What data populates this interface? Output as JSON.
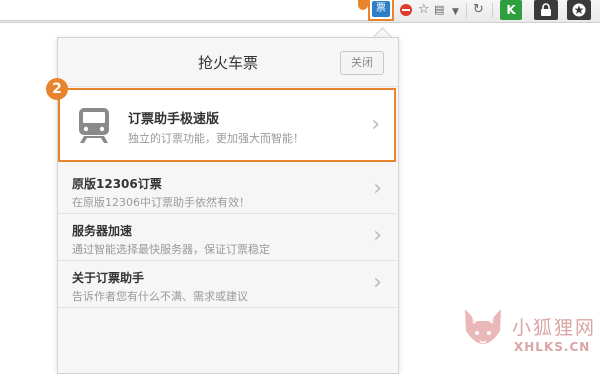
{
  "toolbar": {
    "ticket_ext_label": "票",
    "k_ext_label": "K",
    "lock_icon": "lock-icon",
    "star_icon": "star-icon"
  },
  "popup": {
    "title": "抢火车票",
    "close_label": "关闭",
    "featured": {
      "badge": "2",
      "icon": "train-icon",
      "title": "订票助手极速版",
      "desc": "独立的订票功能，更加强大而智能！"
    },
    "items": [
      {
        "title": "原版12306订票",
        "desc": "在原版12306中订票助手依然有效！"
      },
      {
        "title": "服务器加速",
        "desc": "通过智能选择最快服务器，保证订票稳定"
      },
      {
        "title": "关于订票助手",
        "desc": "告诉作者您有什么不满、需求或建议"
      }
    ]
  },
  "watermark": {
    "cn": "小狐狸网",
    "en": "XHLKS.CN"
  },
  "colors": {
    "accent": "#e8842c",
    "ticket_blue": "#2d7ec9",
    "k_green": "#2e9e3e"
  }
}
